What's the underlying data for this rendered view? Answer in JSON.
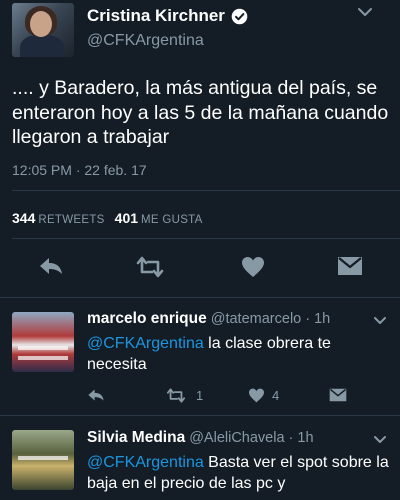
{
  "main_tweet": {
    "name": "Cristina Kirchner",
    "handle": "@CFKArgentina",
    "text": ".... y Baradero, la más antigua del país, se enteraron hoy a las 5 de la mañana cuando llegaron a trabajar",
    "timestamp": "12:05 PM · 22 feb. 17",
    "retweets_count": "344",
    "retweets_label": "RETWEETS",
    "likes_count": "401",
    "likes_label": "ME GUSTA"
  },
  "replies": [
    {
      "name": "marcelo enrique",
      "handle": "@tatemarcelo",
      "time": "· 1h",
      "mention": "@CFKArgentina",
      "text": " la clase obrera te necesita",
      "retweet_count": "1",
      "like_count": "4"
    },
    {
      "name": "Silvia Medina",
      "handle": "@AleliChavela",
      "time": "· 1h",
      "mention": "@CFKArgentina",
      "text": " Basta ver el spot sobre la baja en el precio de las pc y"
    }
  ],
  "colors": {
    "background": "#141d26",
    "secondary_text": "#8899a6",
    "link": "#1b95e0",
    "divider": "#2a3744"
  },
  "icons": [
    "verified-badge-icon",
    "chevron-down-icon",
    "reply-icon",
    "retweet-icon",
    "heart-icon",
    "direct-message-icon"
  ]
}
